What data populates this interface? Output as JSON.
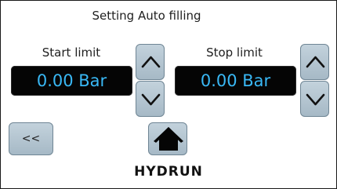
{
  "screen": {
    "title": "Setting Auto filling"
  },
  "start_limit": {
    "label": "Start limit",
    "value": "0.00 Bar",
    "up_icon": "chevron-up-icon",
    "down_icon": "chevron-down-icon"
  },
  "stop_limit": {
    "label": "Stop limit",
    "value": "0.00 Bar",
    "up_icon": "chevron-up-icon",
    "down_icon": "chevron-down-icon"
  },
  "nav": {
    "back_label": "<<",
    "home_icon": "home-icon"
  },
  "brand": {
    "logo_text": "HYDRUN"
  },
  "colors": {
    "value_text": "#39b8f5",
    "value_background": "#050505",
    "button_fill": "#b5c6d2",
    "button_border": "#6f8594"
  }
}
